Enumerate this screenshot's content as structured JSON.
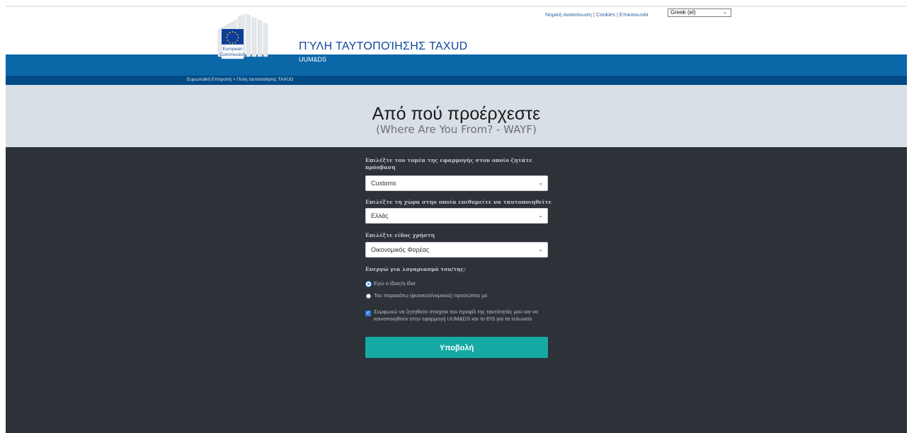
{
  "header": {
    "links": [
      "Νομική ανακοίνωση",
      "Cookies",
      "Επικοινωνία"
    ],
    "language": "Greek (el)",
    "logo_text": [
      "European",
      "Commission"
    ],
    "title": "ΠΎΛΗ ΤΑΥΤΟΠΟΊΗΣΗΣ TAXUD",
    "subtitle": "UUM&DS",
    "breadcrumb": "Ευρωπαϊκή Επιτροπή > Πύλη ταυτοποίησης TAXUD"
  },
  "hero": {
    "title": "Από πού προέρχεστε",
    "subtitle": "(Where Are You From? - WAYF)"
  },
  "form": {
    "domain_label": "Επιλέξτε τον τομέα της εφαρμογής στον οποίο ζητάτε πρόσβαση",
    "domain_value": "Customs",
    "country_label": "Επιλέξτε τη χώρα στην οποία επιθυμείτε να ταυτοποιηθείτε",
    "country_value": "Ελλάς",
    "usertype_label": "Επιλέξτε είδος χρήστη",
    "usertype_value": "Οικονομικός Φορέας",
    "acting_label": "Ενεργώ για λογαριασμό του/της:",
    "option_self": "Εγώ ο ίδιος/η ίδια",
    "option_other": "Του παρακάτω (φυσικού/νομικού) προσώπου με:",
    "consent": "Συμφωνώ να ζητηθούν στοιχεία του προφίλ της ταυτότητάς μου και να κοινοποιηθούν στην εφαρμογή UUM&DS και το EIS για τα τελωνεία",
    "consent_checked": true,
    "selected_option": "self",
    "submit_label": "Υποβολή"
  },
  "colors": {
    "blue_band": "#0b67a7",
    "breadcrumb_band": "#024a85",
    "hero_bg": "#d8dfe6",
    "dark_bg": "#2c3238",
    "submit": "#16a9a4"
  }
}
